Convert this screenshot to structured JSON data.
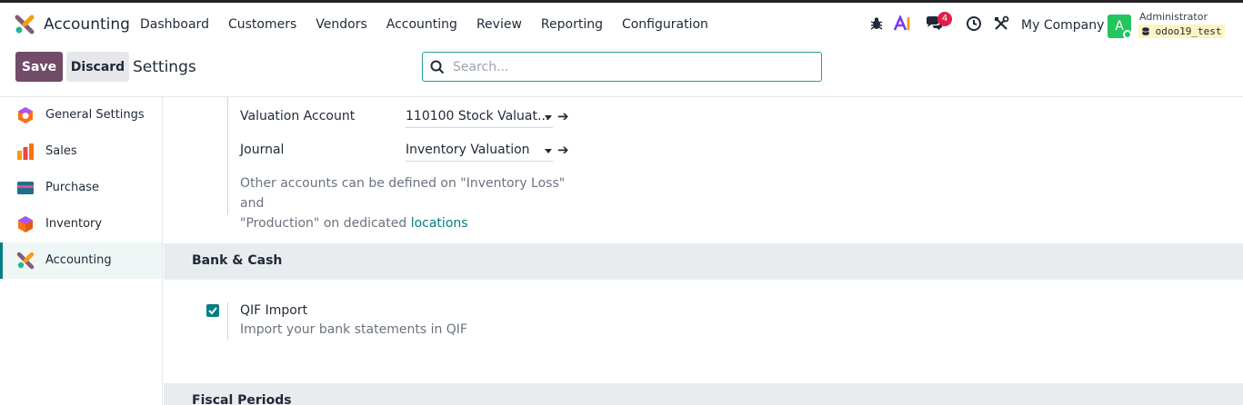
{
  "navbar": {
    "app_name": "Accounting",
    "menu": [
      "Dashboard",
      "Customers",
      "Vendors",
      "Accounting",
      "Review",
      "Reporting",
      "Configuration"
    ],
    "systray": {
      "icons": [
        "bug-icon",
        "ai-icon",
        "chat-icon",
        "clock-icon",
        "tools-icon"
      ],
      "message_count": "4",
      "company": "My Company",
      "avatar_letter": "A",
      "user_name": "Administrator",
      "database": "odoo19_test"
    }
  },
  "control": {
    "save_label": "Save",
    "discard_label": "Discard",
    "page_title": "Settings",
    "search_placeholder": "Search..."
  },
  "sidebar": {
    "items": [
      {
        "label": "General Settings",
        "icon": "general-settings-icon"
      },
      {
        "label": "Sales",
        "icon": "sales-icon"
      },
      {
        "label": "Purchase",
        "icon": "purchase-icon"
      },
      {
        "label": "Inventory",
        "icon": "inventory-icon"
      },
      {
        "label": "Accounting",
        "icon": "accounting-icon",
        "active": true
      }
    ]
  },
  "valuation": {
    "account_label": "Valuation Account",
    "account_value": "110100 Stock Valuat...",
    "journal_label": "Journal",
    "journal_value": "Inventory Valuation",
    "help_line1": "Other accounts can be defined on \"Inventory Loss\" and",
    "help_line2_prefix": "\"Production\" on dedicated ",
    "help_link": "locations"
  },
  "bank_cash": {
    "section_title": "Bank & Cash",
    "qif_title": "QIF Import",
    "qif_desc": "Import your bank statements in QIF",
    "qif_checked": true
  },
  "fiscal": {
    "section_title": "Fiscal Periods"
  },
  "colors": {
    "primary": "#714b67",
    "accent": "#017e84",
    "badge": "#e11d48",
    "avatar": "#22c55e"
  }
}
